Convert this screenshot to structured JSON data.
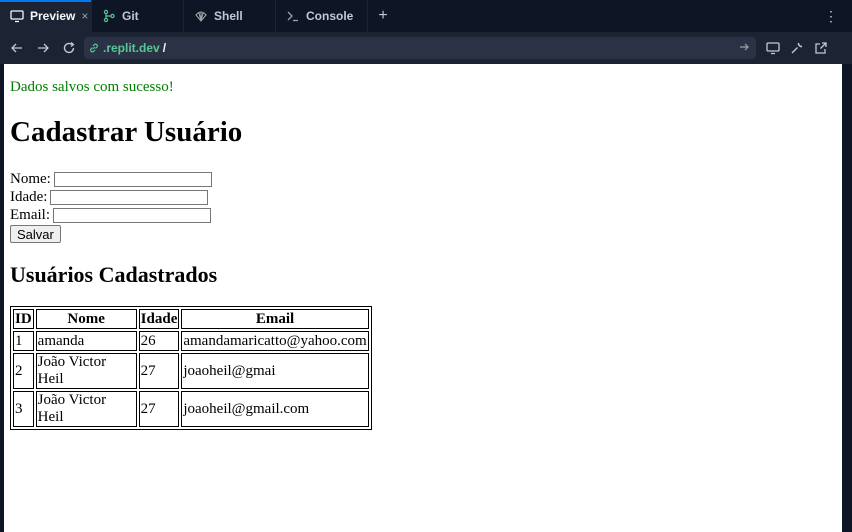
{
  "tabs": [
    {
      "label": "Preview",
      "icon": "monitor-icon",
      "active": true,
      "close": "×"
    },
    {
      "label": "Git",
      "icon": "git-branch-icon"
    },
    {
      "label": "Shell",
      "icon": "shell-icon"
    },
    {
      "label": "Console",
      "icon": "terminal-prompt-icon"
    }
  ],
  "tabbar": {
    "new_tab": "+",
    "menu": "⋮"
  },
  "address": {
    "host": ".replit.dev",
    "path": "/"
  },
  "colors": {
    "accent": "#0079f2",
    "url_host": "#58c896",
    "success": "#008000"
  },
  "page": {
    "message": "Dados salvos com sucesso!",
    "title": "Cadastrar Usuário",
    "form": {
      "name_label": "Nome:",
      "age_label": "Idade:",
      "email_label": "Email:",
      "submit_label": "Salvar"
    },
    "list_title": "Usuários Cadastrados",
    "table": {
      "headers": [
        "ID",
        "Nome",
        "Idade",
        "Email"
      ],
      "rows": [
        [
          "1",
          "amanda",
          "26",
          "amandamaricatto@yahoo.com"
        ],
        [
          "2",
          "João Victor Heil",
          "27",
          "joaoheil@gmai"
        ],
        [
          "3",
          "João Victor Heil",
          "27",
          "joaoheil@gmail.com"
        ]
      ]
    }
  }
}
